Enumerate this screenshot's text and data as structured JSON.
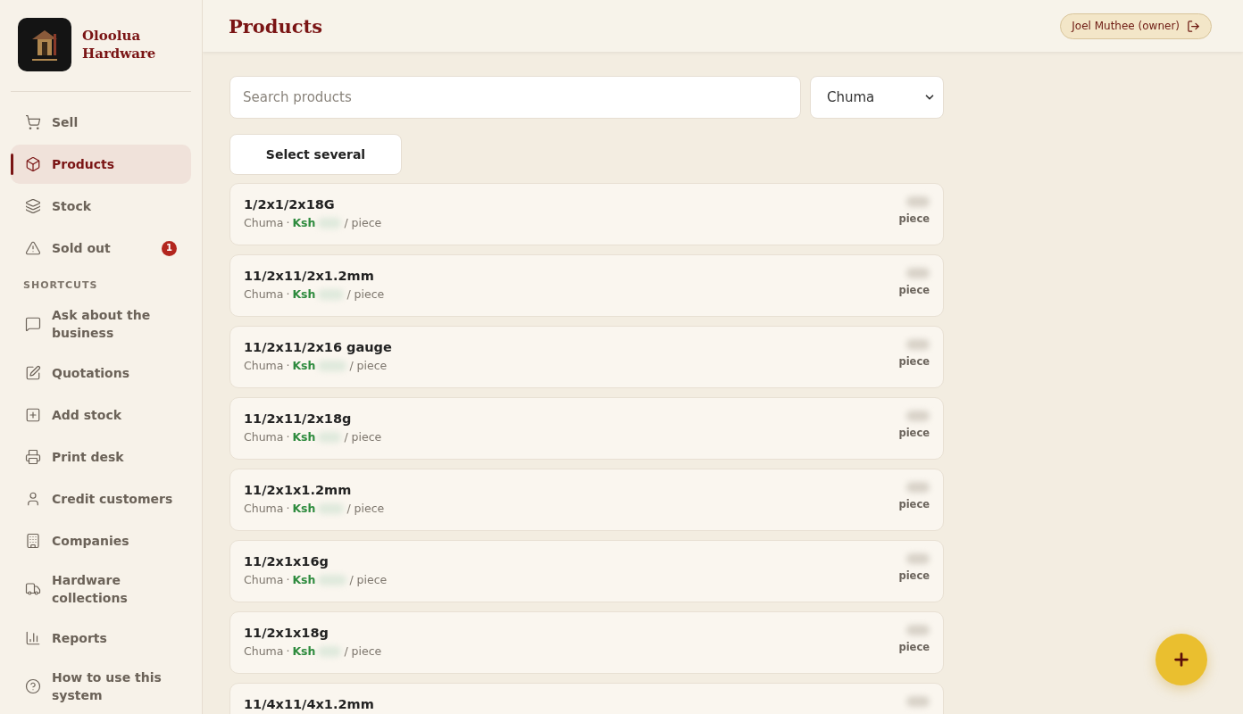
{
  "brand": {
    "name": "Oloolua Hardware"
  },
  "nav": [
    {
      "label": "Sell",
      "selected": false
    },
    {
      "label": "Products",
      "selected": true
    },
    {
      "label": "Stock",
      "selected": false
    },
    {
      "label": "Sold out",
      "selected": false,
      "badge": "1"
    }
  ],
  "shortcuts_heading": "SHORTCUTS",
  "shortcuts": [
    {
      "label": "Ask about the business"
    },
    {
      "label": "Quotations"
    },
    {
      "label": "Add stock"
    },
    {
      "label": "Print desk"
    },
    {
      "label": "Credit customers"
    },
    {
      "label": "Companies"
    },
    {
      "label": "Hardware collections"
    },
    {
      "label": "Reports"
    },
    {
      "label": "How to use this system"
    }
  ],
  "header": {
    "title": "Products",
    "user": "Joel Muthee (owner)"
  },
  "search": {
    "placeholder": "Search products"
  },
  "company_select": {
    "value": "Chuma"
  },
  "select_button": "Select several",
  "products": [
    {
      "name": "1/2x1/2x18G",
      "supplier": "Chuma",
      "separator": "·",
      "currency": "Ksh",
      "unit": "/ piece",
      "stock_unit": "piece"
    },
    {
      "name": "11/2x11/2x1.2mm",
      "supplier": "Chuma",
      "separator": "·",
      "currency": "Ksh",
      "unit": "/ piece",
      "stock_unit": "piece"
    },
    {
      "name": "11/2x11/2x16 gauge",
      "supplier": "Chuma",
      "separator": "·",
      "currency": "Ksh",
      "unit": "/ piece",
      "stock_unit": "piece"
    },
    {
      "name": "11/2x11/2x18g",
      "supplier": "Chuma",
      "separator": "·",
      "currency": "Ksh",
      "unit": "/ piece",
      "stock_unit": "piece"
    },
    {
      "name": "11/2x1x1.2mm",
      "supplier": "Chuma",
      "separator": "·",
      "currency": "Ksh",
      "unit": "/ piece",
      "stock_unit": "piece"
    },
    {
      "name": "11/2x1x16g",
      "supplier": "Chuma",
      "separator": "·",
      "currency": "Ksh",
      "unit": "/ piece",
      "stock_unit": "piece"
    },
    {
      "name": "11/2x1x18g",
      "supplier": "Chuma",
      "separator": "·",
      "currency": "Ksh",
      "unit": "/ piece",
      "stock_unit": "piece"
    },
    {
      "name": "11/4x11/4x1.2mm"
    }
  ]
}
